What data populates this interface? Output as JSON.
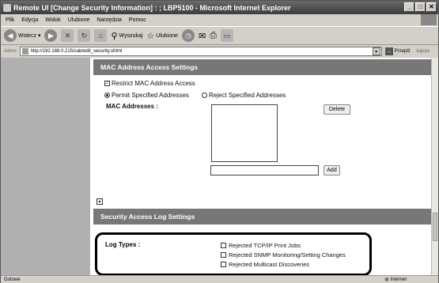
{
  "window": {
    "title": "Remote UI [Change Security Information] : ; LBP5100 - Microsoft Internet Explorer",
    "minimize": "_",
    "maximize": "□",
    "close": "✕"
  },
  "menu": [
    "Plik",
    "Edycja",
    "Widok",
    "Ulubione",
    "Narzędzia",
    "Pomoc"
  ],
  "toolbar": {
    "back": "Wstecz",
    "search": "Wyszukaj",
    "favorites": "Ulubione"
  },
  "address": {
    "label": "Adres",
    "url": "http://192.168.0.215/cab/edit_security.shtml",
    "go": "Przejdź",
    "links": "Łącza"
  },
  "mac_section": {
    "title": "MAC Address Access Settings",
    "restrict_label": "Restrict MAC Address Access",
    "permit_label": "Permit Specified Addresses",
    "reject_label": "Reject Specified Addresses",
    "addresses_label": "MAC Addresses :",
    "delete_button": "Delete",
    "add_button": "Add",
    "to_top": "▲"
  },
  "log_section": {
    "title": "Security Access Log Settings",
    "log_types_label": "Log Types :",
    "options": [
      "Rejected TCP/IP Print Jobs",
      "Rejected SNMP Monitoring/Setting Changes",
      "Rejected Multicast Discoveries"
    ]
  },
  "status": {
    "left": "Gotowe",
    "zone": "Internet"
  },
  "icons": {
    "back": "back-arrow-icon",
    "forward": "forward-arrow-icon",
    "stop": "stop-icon",
    "refresh": "refresh-icon",
    "home": "home-icon",
    "search": "search-icon",
    "favorites": "star-icon",
    "history": "history-icon",
    "mail": "mail-icon",
    "print": "print-icon"
  }
}
